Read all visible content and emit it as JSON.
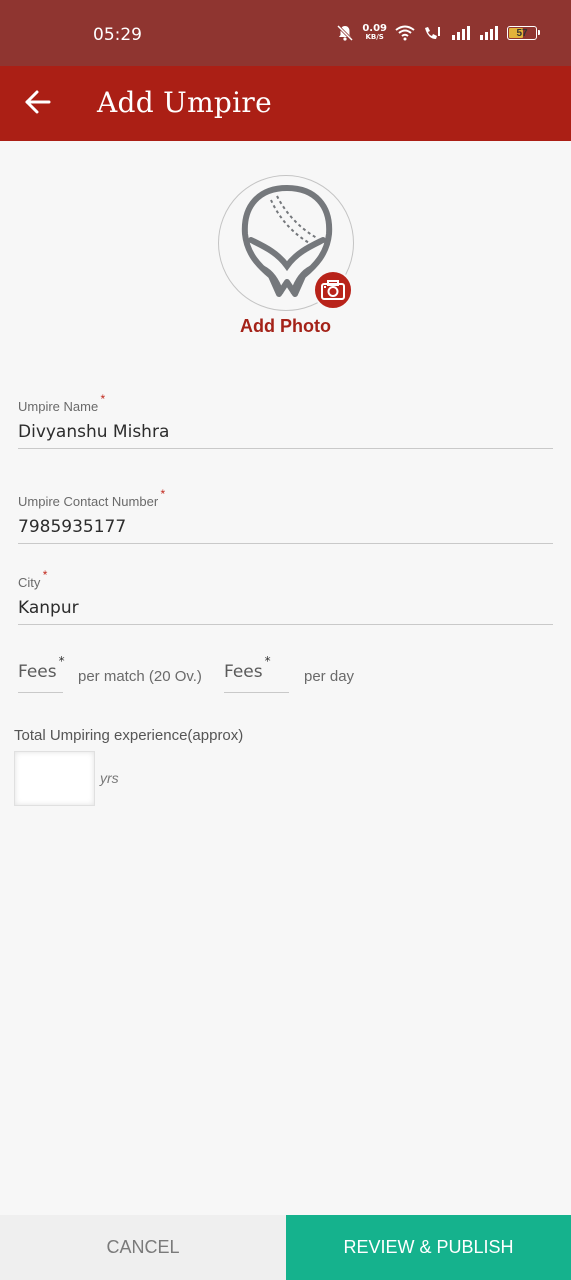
{
  "status_bar": {
    "time": "05:29",
    "net_speed_value": "0.09",
    "net_speed_unit": "KB/S",
    "battery": "57",
    "battery_level": 0.57,
    "icons": [
      "mute-icon",
      "wifi-icon",
      "call-icon",
      "signal-icon",
      "signal-icon",
      "battery-icon"
    ]
  },
  "app_bar": {
    "title": "Add Umpire",
    "back_icon": "arrow-left-icon",
    "color": "#ab1f15"
  },
  "photo": {
    "label": "Add Photo",
    "avatar_icon": "umpire-helmet-icon",
    "camera_icon": "camera-icon"
  },
  "form": {
    "umpire_name": {
      "label": "Umpire Name",
      "required": "*",
      "value": "Divyanshu Mishra"
    },
    "contact_number": {
      "label": "Umpire Contact Number",
      "required": "*",
      "value": "7985935177"
    },
    "city": {
      "label": "City",
      "required": "*",
      "value": "Kanpur"
    },
    "fees_match": {
      "placeholder": "Fees",
      "required": "*",
      "unit": "per match (20 Ov.)"
    },
    "fees_day": {
      "placeholder": "Fees",
      "required": "*",
      "unit": "per day"
    },
    "experience": {
      "label": "Total Umpiring experience(approx)",
      "value": "",
      "unit": "yrs"
    }
  },
  "actions": {
    "cancel": "CANCEL",
    "publish": "REVIEW & PUBLISH",
    "publish_color": "#15b28d"
  }
}
